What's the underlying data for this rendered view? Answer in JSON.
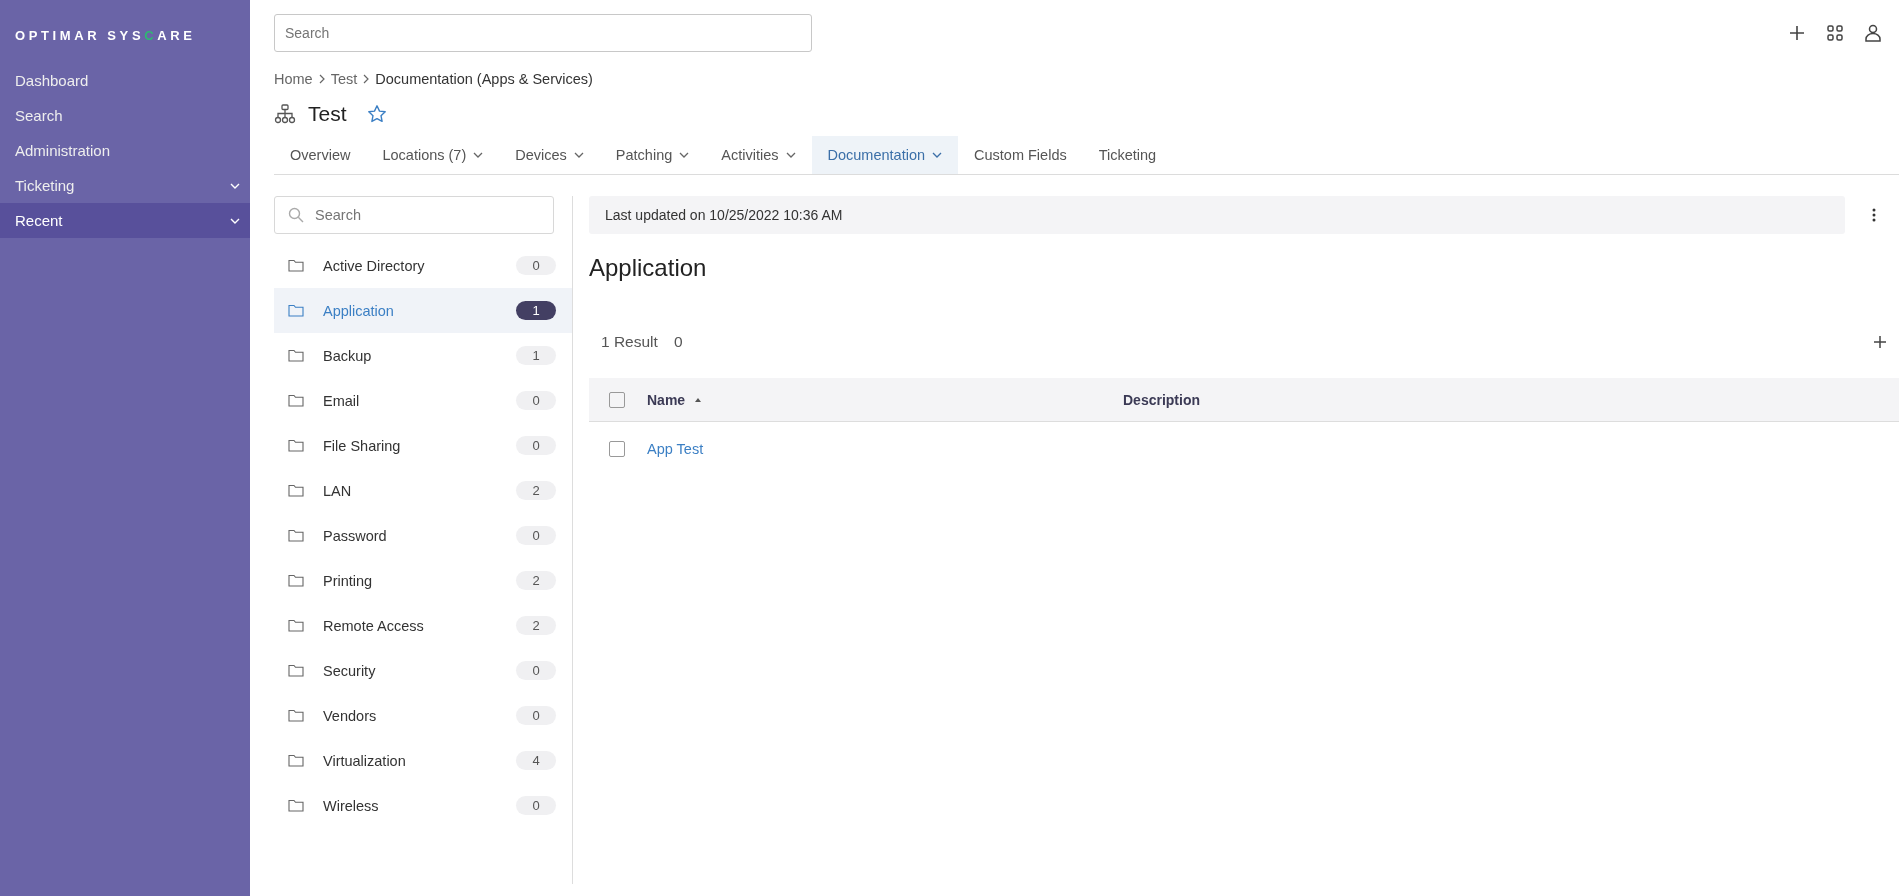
{
  "logo": {
    "before": "OPTIMAR SYS",
    "accent": "C",
    "after": "ARE"
  },
  "sidebar": {
    "items": [
      {
        "label": "Dashboard",
        "expandable": false,
        "selected": false
      },
      {
        "label": "Search",
        "expandable": false,
        "selected": false
      },
      {
        "label": "Administration",
        "expandable": false,
        "selected": false
      },
      {
        "label": "Ticketing",
        "expandable": true,
        "selected": false
      },
      {
        "label": "Recent",
        "expandable": true,
        "selected": true
      }
    ]
  },
  "top_search": {
    "placeholder": "Search"
  },
  "breadcrumb": [
    "Home",
    "Test",
    "Documentation (Apps & Services)"
  ],
  "page_title": "Test",
  "favorite": false,
  "tabs": [
    {
      "label": "Overview",
      "dropdown": false,
      "selected": false
    },
    {
      "label": "Locations (7)",
      "dropdown": true,
      "selected": false
    },
    {
      "label": "Devices",
      "dropdown": true,
      "selected": false
    },
    {
      "label": "Patching",
      "dropdown": true,
      "selected": false
    },
    {
      "label": "Activities",
      "dropdown": true,
      "selected": false
    },
    {
      "label": "Documentation",
      "dropdown": true,
      "selected": true
    },
    {
      "label": "Custom Fields",
      "dropdown": false,
      "selected": false
    },
    {
      "label": "Ticketing",
      "dropdown": false,
      "selected": false
    }
  ],
  "category_search": {
    "placeholder": "Search"
  },
  "categories": [
    {
      "label": "Active Directory",
      "count": "0",
      "selected": false
    },
    {
      "label": "Application",
      "count": "1",
      "selected": true
    },
    {
      "label": "Backup",
      "count": "1",
      "selected": false
    },
    {
      "label": "Email",
      "count": "0",
      "selected": false
    },
    {
      "label": "File Sharing",
      "count": "0",
      "selected": false
    },
    {
      "label": "LAN",
      "count": "2",
      "selected": false
    },
    {
      "label": "Password",
      "count": "0",
      "selected": false
    },
    {
      "label": "Printing",
      "count": "2",
      "selected": false
    },
    {
      "label": "Remote Access",
      "count": "2",
      "selected": false
    },
    {
      "label": "Security",
      "count": "0",
      "selected": false
    },
    {
      "label": "Vendors",
      "count": "0",
      "selected": false
    },
    {
      "label": "Virtualization",
      "count": "4",
      "selected": false
    },
    {
      "label": "Wireless",
      "count": "0",
      "selected": false
    }
  ],
  "last_updated": "Last updated on 10/25/2022 10:36 AM",
  "section_title": "Application",
  "results": {
    "label": "1 Result",
    "extra": "0"
  },
  "table": {
    "header_checked": false,
    "columns": [
      {
        "label": "Name",
        "sorted": true
      },
      {
        "label": "Description",
        "sorted": false
      }
    ],
    "rows": [
      {
        "checked": false,
        "name": "App Test"
      }
    ]
  }
}
